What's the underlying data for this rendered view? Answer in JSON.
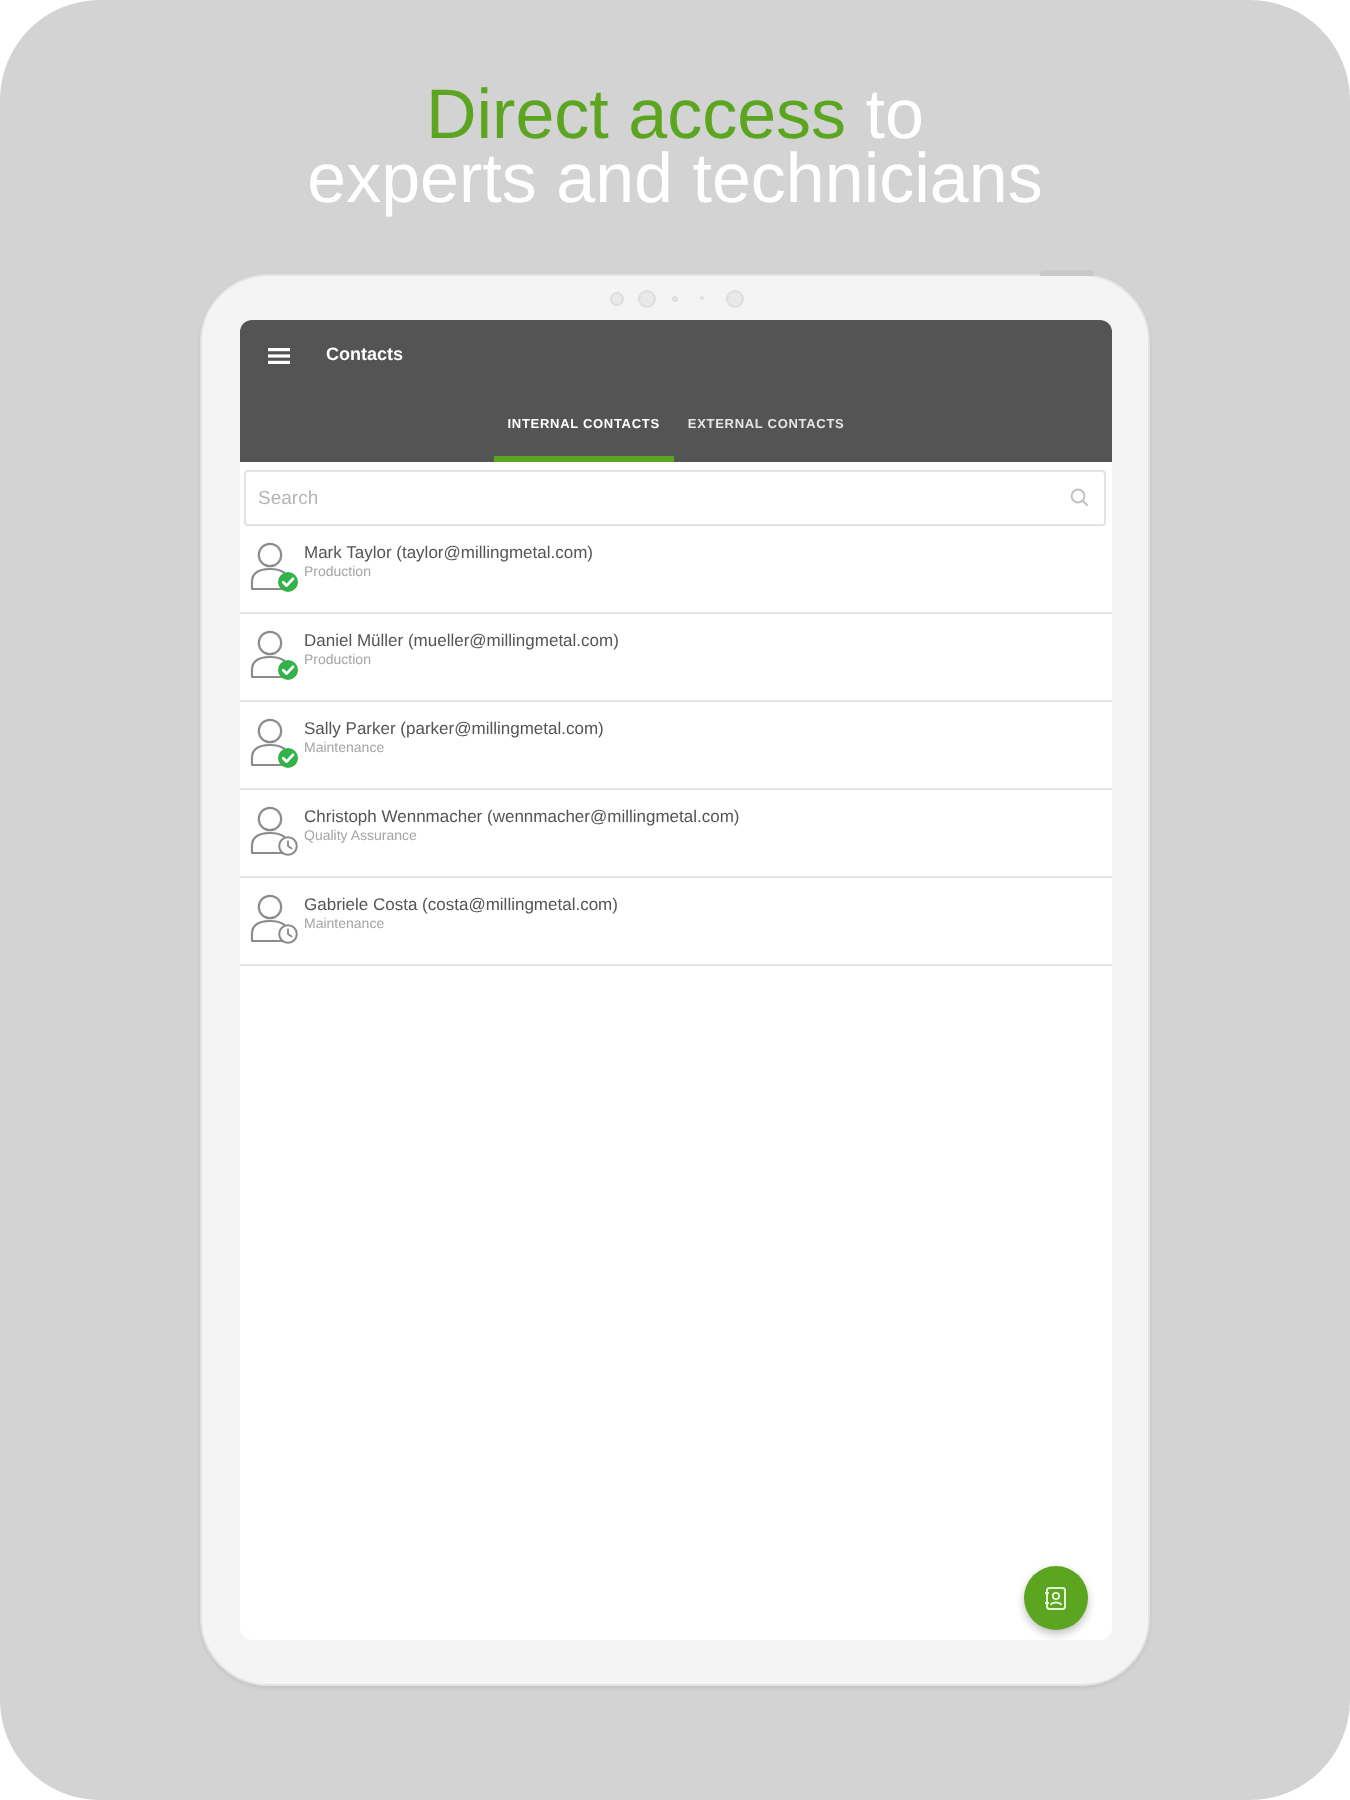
{
  "headline": {
    "lines": [
      [
        {
          "text": "Direct access",
          "accent": true
        },
        {
          "text": "to",
          "accent": false
        }
      ],
      [
        {
          "text": "experts and technicians",
          "accent": false
        }
      ]
    ]
  },
  "app_bar": {
    "title": "Contacts"
  },
  "tabs": [
    {
      "label": "INTERNAL CONTACTS",
      "selected": true
    },
    {
      "label": "EXTERNAL CONTACTS",
      "selected": false
    }
  ],
  "search": {
    "placeholder": "Search"
  },
  "contacts": [
    {
      "name": "Mark Taylor (taylor@millingmetal.com)",
      "department": "Production",
      "available": true
    },
    {
      "name": "Daniel Müller (mueller@millingmetal.com)",
      "department": "Production",
      "available": true
    },
    {
      "name": "Sally Parker (parker@millingmetal.com)",
      "department": "Maintenance",
      "available": true
    },
    {
      "name": "Christoph Wennmacher (wennmacher@millingmetal.com)",
      "department": "Quality Assurance",
      "available": false
    },
    {
      "name": "Gabriele Costa (costa@millingmetal.com)",
      "department": "Maintenance",
      "available": false
    }
  ]
}
